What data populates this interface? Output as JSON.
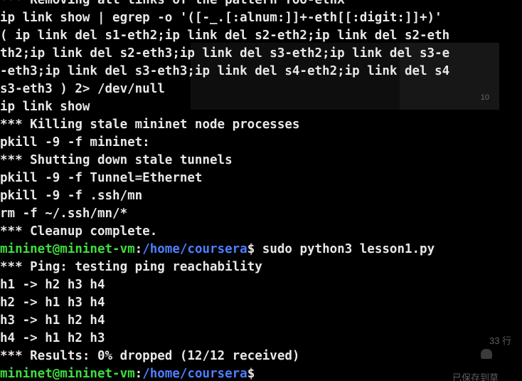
{
  "background_window": {
    "badge": "10",
    "line_count": "33 行",
    "footer": "已保存到草"
  },
  "colors": {
    "background": "#000000",
    "text": "#e8e8e8",
    "prompt_user": "#3fdd3f",
    "prompt_path": "#4d7fff"
  },
  "terminal": {
    "lines": [
      "*** Removing all links of the pattern foo-ethX",
      "ip link show | egrep -o '([-_.[:alnum:]]+-eth[[:digit:]]+)'",
      "( ip link del s1-eth2;ip link del s2-eth2;ip link del s2-eth",
      "th2;ip link del s2-eth3;ip link del s3-eth2;ip link del s3-e",
      "-eth3;ip link del s3-eth3;ip link del s4-eth2;ip link del s4",
      "s3-eth3 ) 2> /dev/null",
      "ip link show",
      "*** Killing stale mininet node processes",
      "pkill -9 -f mininet:",
      "*** Shutting down stale tunnels",
      "pkill -9 -f Tunnel=Ethernet",
      "pkill -9 -f .ssh/mn",
      "rm -f ~/.ssh/mn/*",
      "*** Cleanup complete."
    ],
    "prompt1": {
      "user": "mininet@mininet-vm",
      "colon": ":",
      "path": "/home/coursera",
      "sign": "$",
      "command": " sudo python3 lesson1.py"
    },
    "output": [
      "*** Ping: testing ping reachability",
      "h1 -> h2 h3 h4",
      "h2 -> h1 h3 h4",
      "h3 -> h1 h2 h4",
      "h4 -> h1 h2 h3",
      "*** Results: 0% dropped (12/12 received)"
    ],
    "prompt2": {
      "user": "mininet@mininet-vm",
      "colon": ":",
      "path": "/home/coursera",
      "sign": "$",
      "command": ""
    }
  }
}
